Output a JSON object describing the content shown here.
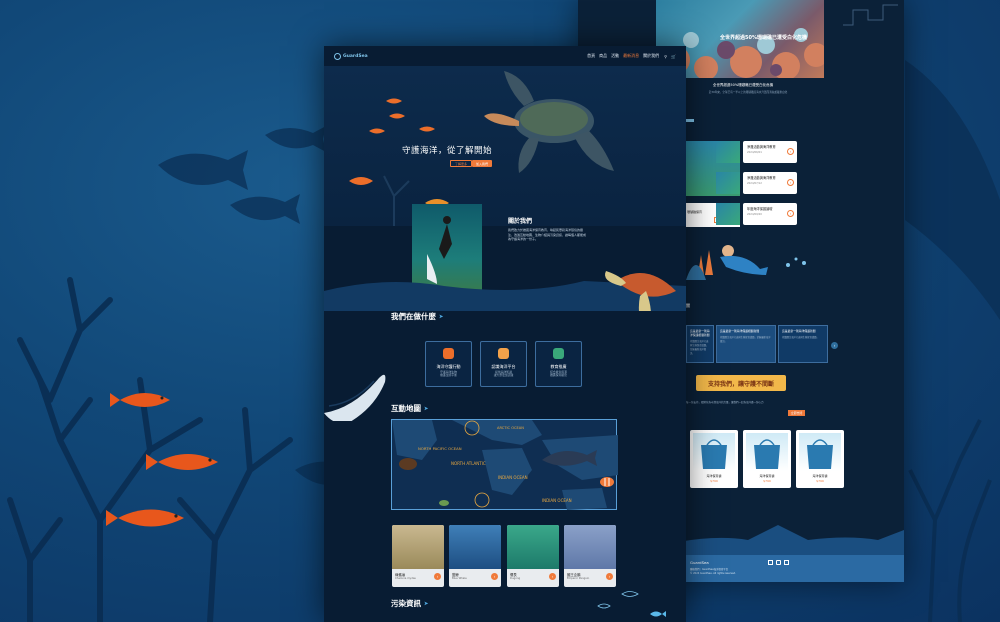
{
  "brand": {
    "name": "GuardSea",
    "accent": "#f07a3a",
    "navy": "#081c33"
  },
  "nav": {
    "items": [
      "首頁",
      "商品",
      "活動",
      "最新消息",
      "關於我們"
    ],
    "active_index": 3
  },
  "hero": {
    "title": "守護海洋，從了解開始",
    "btn_primary": "了解更多",
    "btn_secondary": "加入我們"
  },
  "about": {
    "title": "關於我們",
    "body": "我們致力於推廣海洋保育教育，喚起民眾對海洋環境的關注，透過互動地圖、生物介紹與污染資訊，讓每個人都能成為守護海洋的一份子。"
  },
  "what_we_do": {
    "title": "我們在做什麼",
    "cards": [
      {
        "title": "海洋守護行動",
        "desc": "守護海洋生物\n維護生態平衡",
        "icon": "coral-icon"
      },
      {
        "title": "認識海洋平台",
        "desc": "提供海洋知識\n讓大眾更加認識",
        "icon": "fish-icon"
      },
      {
        "title": "教育推廣",
        "desc": "結合教育資源\n推廣保育觀念",
        "icon": "book-icon"
      }
    ]
  },
  "map": {
    "title": "互動地圖",
    "labels": [
      "NORTH PACIFIC OCEAN",
      "ARCTIC OCEAN",
      "NORTH ATLANTIC",
      "INDIAN OCEAN",
      "INDIAN OCEAN"
    ]
  },
  "animals": [
    {
      "name": "綠蠵龜",
      "en": "Chelonia mydas"
    },
    {
      "name": "藍鯨",
      "en": "Blue Whale"
    },
    {
      "name": "儒艮",
      "en": "Dugong"
    },
    {
      "name": "國王企鵝",
      "en": "Emperor Penguin"
    }
  ],
  "pollution": {
    "title": "污染資訊"
  },
  "back": {
    "banner_caption": "全世界超過50%珊瑚礁已遭受白化危機",
    "banner_text": "全世界超過50%珊瑚礁已遭受白化危機",
    "banner_sub": "近30年來，全球已有一半以上的珊瑚礁因海水升溫而消失或嚴重白化",
    "events": [
      {
        "title": "淨灘活動與海洋教育",
        "date": "2024/06/01"
      },
      {
        "title": "淨灘活動與海洋教育",
        "date": "2024/07/12"
      },
      {
        "title": "年度海洋保護論壇",
        "date": "2024/09/20"
      }
    ],
    "event_more": "查看更多",
    "event_side": "珊瑚礁保育",
    "news": [
      {
        "title": "這是最新一則海洋保護相關新聞",
        "body": "持續關注海洋污染與生態保育議題，掌握最新海洋資訊。"
      },
      {
        "title": "這是最新一則海洋保護新聞",
        "body": "持續關注海洋污染與生態保育議題。"
      }
    ],
    "support_title": "支持我們，讓守護不間斷",
    "support_text": "每一份支持，都將化為守護海洋的力量，讓我們一起為海洋盡一份心力",
    "support_btn": "立即支持",
    "products": [
      {
        "name": "海洋保育袋",
        "price": "$799"
      },
      {
        "name": "海洋保育袋",
        "price": "$799"
      },
      {
        "name": "海洋保育袋",
        "price": "$799"
      }
    ],
    "footer_brand": "GuardSea",
    "footer_line1": "聯絡我們｜GuardSea海洋保育平台",
    "footer_line2": "© 2024 GuardSea. All rights reserved."
  }
}
